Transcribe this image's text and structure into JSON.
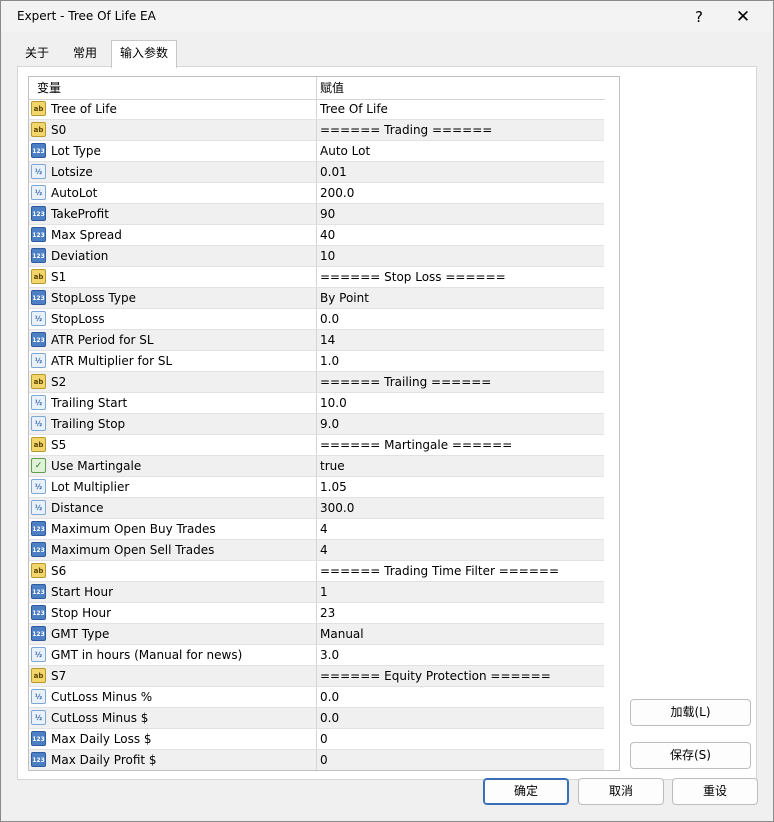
{
  "window": {
    "title": "Expert - Tree Of Life EA",
    "help_label": "?",
    "close_label": "✕"
  },
  "tabs": [
    {
      "label": "关于"
    },
    {
      "label": "常用"
    },
    {
      "label": "输入参数",
      "active": true
    }
  ],
  "grid": {
    "columns": {
      "variable": "变量",
      "value": "赋值"
    },
    "rows": [
      {
        "icon": "ab",
        "name": "Tree of Life",
        "value": "Tree Of Life"
      },
      {
        "icon": "ab",
        "name": "S0",
        "value": "====== Trading ======"
      },
      {
        "icon": "123",
        "name": "Lot Type",
        "value": "Auto Lot"
      },
      {
        "icon": "1/2",
        "name": "Lotsize",
        "value": "0.01"
      },
      {
        "icon": "1/2",
        "name": "AutoLot",
        "value": "200.0"
      },
      {
        "icon": "123",
        "name": "TakeProfit",
        "value": "90"
      },
      {
        "icon": "123",
        "name": "Max Spread",
        "value": "40"
      },
      {
        "icon": "123",
        "name": "Deviation",
        "value": "10"
      },
      {
        "icon": "ab",
        "name": "S1",
        "value": "====== Stop Loss ======"
      },
      {
        "icon": "123",
        "name": "StopLoss Type",
        "value": "By Point"
      },
      {
        "icon": "1/2",
        "name": "StopLoss",
        "value": "0.0"
      },
      {
        "icon": "123",
        "name": "ATR Period for SL",
        "value": "14"
      },
      {
        "icon": "1/2",
        "name": "ATR Multiplier for SL",
        "value": "1.0"
      },
      {
        "icon": "ab",
        "name": "S2",
        "value": "====== Trailing ======"
      },
      {
        "icon": "1/2",
        "name": "Trailing Start",
        "value": "10.0"
      },
      {
        "icon": "1/2",
        "name": "Trailing Stop",
        "value": "9.0"
      },
      {
        "icon": "ab",
        "name": "S5",
        "value": "====== Martingale ======"
      },
      {
        "icon": "bool",
        "name": "Use Martingale",
        "value": "true"
      },
      {
        "icon": "1/2",
        "name": "Lot Multiplier",
        "value": "1.05"
      },
      {
        "icon": "1/2",
        "name": "Distance",
        "value": "300.0"
      },
      {
        "icon": "123",
        "name": "Maximum Open Buy Trades",
        "value": "4"
      },
      {
        "icon": "123",
        "name": "Maximum Open Sell Trades",
        "value": "4"
      },
      {
        "icon": "ab",
        "name": "S6",
        "value": "====== Trading Time Filter ======"
      },
      {
        "icon": "123",
        "name": "Start Hour",
        "value": "1"
      },
      {
        "icon": "123",
        "name": "Stop Hour",
        "value": "23"
      },
      {
        "icon": "123",
        "name": "GMT Type",
        "value": "Manual"
      },
      {
        "icon": "1/2",
        "name": "GMT in hours (Manual for news)",
        "value": "3.0"
      },
      {
        "icon": "ab",
        "name": "S7",
        "value": "====== Equity Protection ======"
      },
      {
        "icon": "1/2",
        "name": "CutLoss Minus %",
        "value": "0.0"
      },
      {
        "icon": "1/2",
        "name": "CutLoss Minus $",
        "value": "0.0"
      },
      {
        "icon": "123",
        "name": "Max Daily Loss $",
        "value": "0"
      },
      {
        "icon": "123",
        "name": "Max Daily Profit $",
        "value": "0"
      }
    ]
  },
  "buttons": {
    "load": "加载(L)",
    "save": "保存(S)",
    "ok": "确定",
    "cancel": "取消",
    "reset": "重设"
  }
}
